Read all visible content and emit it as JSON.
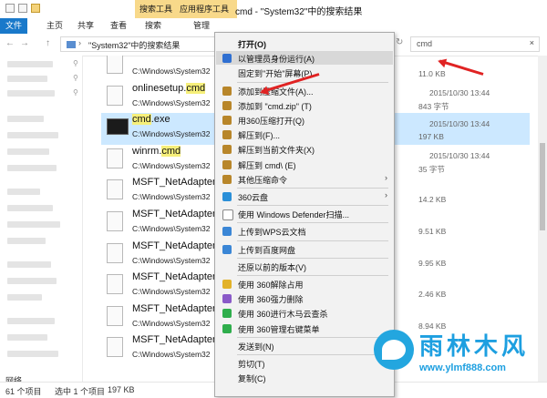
{
  "window": {
    "title": "cmd - \"System32\"中的搜索结果",
    "context_tabs": [
      "搜索工具",
      "应用程序工具"
    ],
    "ribbon_tabs": [
      "文件",
      "主页",
      "共享",
      "查看",
      "搜索",
      "管理"
    ]
  },
  "address": {
    "back": "←",
    "forward": "→",
    "up": "↑",
    "path": "\"System32\"中的搜索结果",
    "search_value": "cmd"
  },
  "files": [
    {
      "name": "",
      "path": "C:\\Windows\\System32",
      "date": "",
      "size": "11.0 KB",
      "icon": "document-icon"
    },
    {
      "name": "onlinesetup.cmd",
      "hl": "cmd",
      "path": "C:\\Windows\\System32",
      "date": "2015/10/30 13:44",
      "size": "843 字节",
      "icon": "script-icon"
    },
    {
      "name": "cmd.exe",
      "hl": "cmd",
      "path": "C:\\Windows\\System32",
      "date": "2015/10/30 13:44",
      "size": "197 KB",
      "icon": "console-icon",
      "selected": true
    },
    {
      "name": "winrm.cmd",
      "hl": "cmd",
      "path": "C:\\Windows\\System32",
      "date": "2015/10/30 13:44",
      "size": "35 字节",
      "icon": "script-icon"
    },
    {
      "name": "MSFT_NetAdapter",
      "path": "C:\\Windows\\System32",
      "date": "",
      "size": "14.2 KB",
      "icon": "document-icon"
    },
    {
      "name": "MSFT_NetAdapter",
      "path": "C:\\Windows\\System32",
      "date": "",
      "size": "9.51 KB",
      "icon": "document-icon"
    },
    {
      "name": "MSFT_NetAdapter",
      "path": "C:\\Windows\\System32",
      "date": "",
      "size": "9.95 KB",
      "icon": "document-icon"
    },
    {
      "name": "MSFT_NetAdapter",
      "path": "C:\\Windows\\System32",
      "date": "",
      "size": "2.46 KB",
      "icon": "document-icon"
    },
    {
      "name": "MSFT_NetAdapter",
      "path": "C:\\Windows\\System32",
      "date": "",
      "size": "8.94 KB",
      "icon": "document-icon"
    },
    {
      "name": "MSFT_NetAdapter",
      "path": "C:\\Windows\\System32",
      "date": "",
      "size": "",
      "icon": "document-icon"
    }
  ],
  "navpane": {
    "network": "网络"
  },
  "status": {
    "count": "61 个项目",
    "selected": "选中 1 个项目",
    "size": "197 KB"
  },
  "context_menu": [
    {
      "label": "打开(O)",
      "bold": true
    },
    {
      "label": "以管理员身份运行(A)",
      "icon": "admin-shield-icon",
      "color": "#2f6fd1",
      "hover": true
    },
    {
      "label": "固定到\"开始\"屏幕(P)"
    },
    {
      "sep": true
    },
    {
      "label": "添加到压缩文件(A)...",
      "icon": "archive-icon",
      "color": "#b8862a"
    },
    {
      "label": "添加到 \"cmd.zip\" (T)",
      "icon": "archive-icon",
      "color": "#b8862a"
    },
    {
      "label": "用360压缩打开(Q)",
      "icon": "archive-icon",
      "color": "#b8862a"
    },
    {
      "label": "解压到(F)...",
      "icon": "archive-icon",
      "color": "#b8862a"
    },
    {
      "label": "解压到当前文件夹(X)",
      "icon": "archive-icon",
      "color": "#b8862a"
    },
    {
      "label": "解压到 cmd\\ (E)",
      "icon": "archive-icon",
      "color": "#b8862a"
    },
    {
      "label": "其他压缩命令",
      "icon": "archive-icon",
      "color": "#b8862a",
      "submenu": true
    },
    {
      "sep": true
    },
    {
      "label": "360云盘",
      "icon": "cloud-icon",
      "color": "#2a8fd8",
      "submenu": true
    },
    {
      "sep": true
    },
    {
      "label": "使用 Windows Defender扫描...",
      "icon": "defender-icon",
      "color": "#ffffff"
    },
    {
      "sep": true
    },
    {
      "label": "上传到WPS云文档",
      "icon": "wps-cloud-icon",
      "color": "#3a86d6"
    },
    {
      "sep": true
    },
    {
      "label": "上传到百度网盘",
      "icon": "baidu-cloud-icon",
      "color": "#3a86d6"
    },
    {
      "sep": true
    },
    {
      "label": "还原以前的版本(V)"
    },
    {
      "sep": true
    },
    {
      "label": "使用 360解除占用",
      "icon": "unlock-icon",
      "color": "#e2b229"
    },
    {
      "label": "使用 360强力删除",
      "icon": "shred-icon",
      "color": "#8a5ac8"
    },
    {
      "label": "使用 360进行木马云查杀",
      "icon": "shield-360-icon",
      "color": "#2fae4c"
    },
    {
      "label": "使用 360管理右键菜单",
      "icon": "menu-360-icon",
      "color": "#2fae4c"
    },
    {
      "sep": true
    },
    {
      "label": "发送到(N)",
      "submenu": true
    },
    {
      "sep": true
    },
    {
      "label": "剪切(T)"
    },
    {
      "label": "复制(C)"
    }
  ],
  "watermark": {
    "brand": "雨林木风",
    "url": "www.ylmf888.com"
  },
  "colors": {
    "file_tab": "#1979ca",
    "context_tab": "#f8d98a",
    "selection": "#cce8ff",
    "highlight": "#f6ef7a",
    "arrow": "#e02323",
    "brand": "#1d9fe0"
  }
}
